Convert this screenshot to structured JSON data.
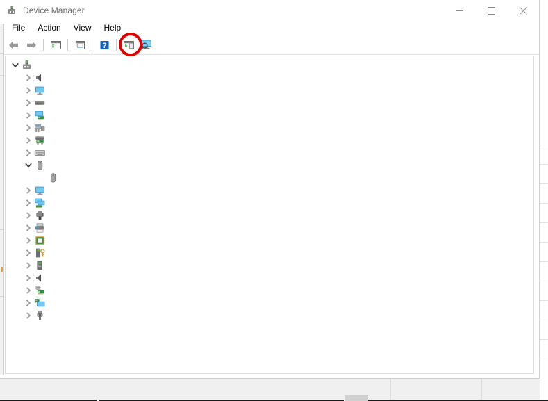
{
  "window": {
    "title": "Device Manager",
    "title_icon": "device-manager-icon",
    "controls": {
      "minimize": "—",
      "maximize": "□",
      "close": "✕"
    }
  },
  "menubar": {
    "items": [
      {
        "label": "File",
        "name": "menu-file"
      },
      {
        "label": "Action",
        "name": "menu-action"
      },
      {
        "label": "View",
        "name": "menu-view"
      },
      {
        "label": "Help",
        "name": "menu-help"
      }
    ]
  },
  "toolbar": {
    "buttons": [
      {
        "name": "back-button",
        "icon": "back-arrow-icon"
      },
      {
        "name": "forward-button",
        "icon": "forward-arrow-icon"
      },
      {
        "name": "show-hide-tree-button",
        "icon": "tree-pane-icon"
      },
      {
        "name": "properties-button",
        "icon": "properties-icon"
      },
      {
        "name": "help-button",
        "icon": "help-question-icon"
      },
      {
        "name": "update-driver-button",
        "icon": "update-driver-icon"
      },
      {
        "name": "scan-hardware-changes-button",
        "icon": "scan-monitor-icon"
      }
    ]
  },
  "annotation": {
    "name": "red-highlight-circle",
    "color": "#e00000",
    "target": "scan-hardware-changes-button"
  },
  "tree": {
    "rows": [
      {
        "name": "tree-root-computer",
        "icon": "computer-icon",
        "indent": 0,
        "state": "expanded",
        "label": ""
      },
      {
        "name": "tree-item-audio",
        "icon": "speaker-icon",
        "indent": 1,
        "state": "collapsed",
        "label": ""
      },
      {
        "name": "tree-item-display-1",
        "icon": "monitor-icon",
        "indent": 1,
        "state": "collapsed",
        "label": ""
      },
      {
        "name": "tree-item-disk-drives",
        "icon": "disk-drive-icon",
        "indent": 1,
        "state": "collapsed",
        "label": ""
      },
      {
        "name": "tree-item-display-adapters",
        "icon": "display-adapter-icon",
        "indent": 1,
        "state": "collapsed",
        "label": ""
      },
      {
        "name": "tree-item-hid",
        "icon": "hid-devices-icon",
        "indent": 1,
        "state": "collapsed",
        "label": ""
      },
      {
        "name": "tree-item-network-card",
        "icon": "network-card-icon",
        "indent": 1,
        "state": "collapsed",
        "label": ""
      },
      {
        "name": "tree-item-keyboards",
        "icon": "keyboard-icon",
        "indent": 1,
        "state": "collapsed",
        "label": ""
      },
      {
        "name": "tree-item-mice",
        "icon": "mouse-icon",
        "indent": 1,
        "state": "expanded",
        "label": ""
      },
      {
        "name": "tree-child-mouse-device",
        "icon": "mouse-icon",
        "indent": 2,
        "state": "leaf",
        "label": ""
      },
      {
        "name": "tree-item-monitors",
        "icon": "monitor-icon",
        "indent": 1,
        "state": "collapsed",
        "label": ""
      },
      {
        "name": "tree-item-network-adapters",
        "icon": "network-adapters-icon",
        "indent": 1,
        "state": "collapsed",
        "label": ""
      },
      {
        "name": "tree-item-ports",
        "icon": "port-connector-icon",
        "indent": 1,
        "state": "collapsed",
        "label": ""
      },
      {
        "name": "tree-item-print-queues",
        "icon": "printer-icon",
        "indent": 1,
        "state": "collapsed",
        "label": ""
      },
      {
        "name": "tree-item-processors",
        "icon": "processor-icon",
        "indent": 1,
        "state": "collapsed",
        "label": ""
      },
      {
        "name": "tree-item-security-devices",
        "icon": "security-key-icon",
        "indent": 1,
        "state": "collapsed",
        "label": ""
      },
      {
        "name": "tree-item-software-devices",
        "icon": "software-device-icon",
        "indent": 1,
        "state": "collapsed",
        "label": ""
      },
      {
        "name": "tree-item-sound-controllers",
        "icon": "speaker-icon",
        "indent": 1,
        "state": "collapsed",
        "label": ""
      },
      {
        "name": "tree-item-storage-controllers",
        "icon": "storage-controller-icon",
        "indent": 1,
        "state": "collapsed",
        "label": ""
      },
      {
        "name": "tree-item-system-devices",
        "icon": "system-device-icon",
        "indent": 1,
        "state": "collapsed",
        "label": ""
      },
      {
        "name": "tree-item-usb-controllers",
        "icon": "usb-icon",
        "indent": 1,
        "state": "collapsed",
        "label": ""
      }
    ]
  },
  "statusbar": {
    "panels": [
      {
        "name": "status-panel-main",
        "text": ""
      },
      {
        "name": "status-panel-two",
        "text": ""
      },
      {
        "name": "status-panel-three",
        "text": ""
      }
    ]
  },
  "colors": {
    "accent_red": "#e00000",
    "window_bg": "#ffffff",
    "chrome_bg": "#f0f0f0",
    "border": "#dcdcdc",
    "title_text": "#6e6e6e"
  }
}
